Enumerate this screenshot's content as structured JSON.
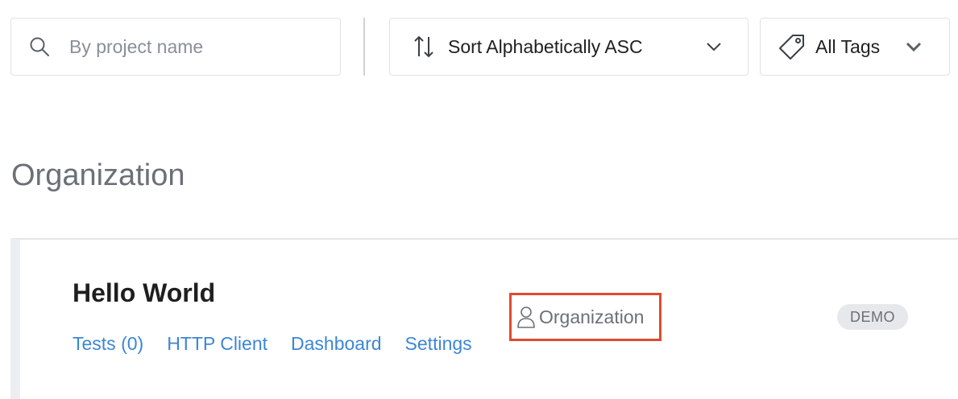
{
  "search": {
    "placeholder": "By project name",
    "value": "",
    "icon": "search-icon"
  },
  "sort": {
    "label": "Sort Alphabetically ASC",
    "icon": "sort-icon"
  },
  "tags": {
    "label": "All Tags",
    "icon": "tag-icon"
  },
  "section": {
    "title": "Organization"
  },
  "project": {
    "name": "Hello World",
    "links": [
      {
        "label": "Tests (0)"
      },
      {
        "label": "HTTP Client"
      },
      {
        "label": "Dashboard"
      },
      {
        "label": "Settings"
      }
    ],
    "owner": "Organization",
    "badge": "DEMO"
  },
  "colors": {
    "link": "#3c86d6",
    "highlight_border": "#e04a2f",
    "muted_text": "#6b7078",
    "badge_bg": "#e6e8eb"
  }
}
